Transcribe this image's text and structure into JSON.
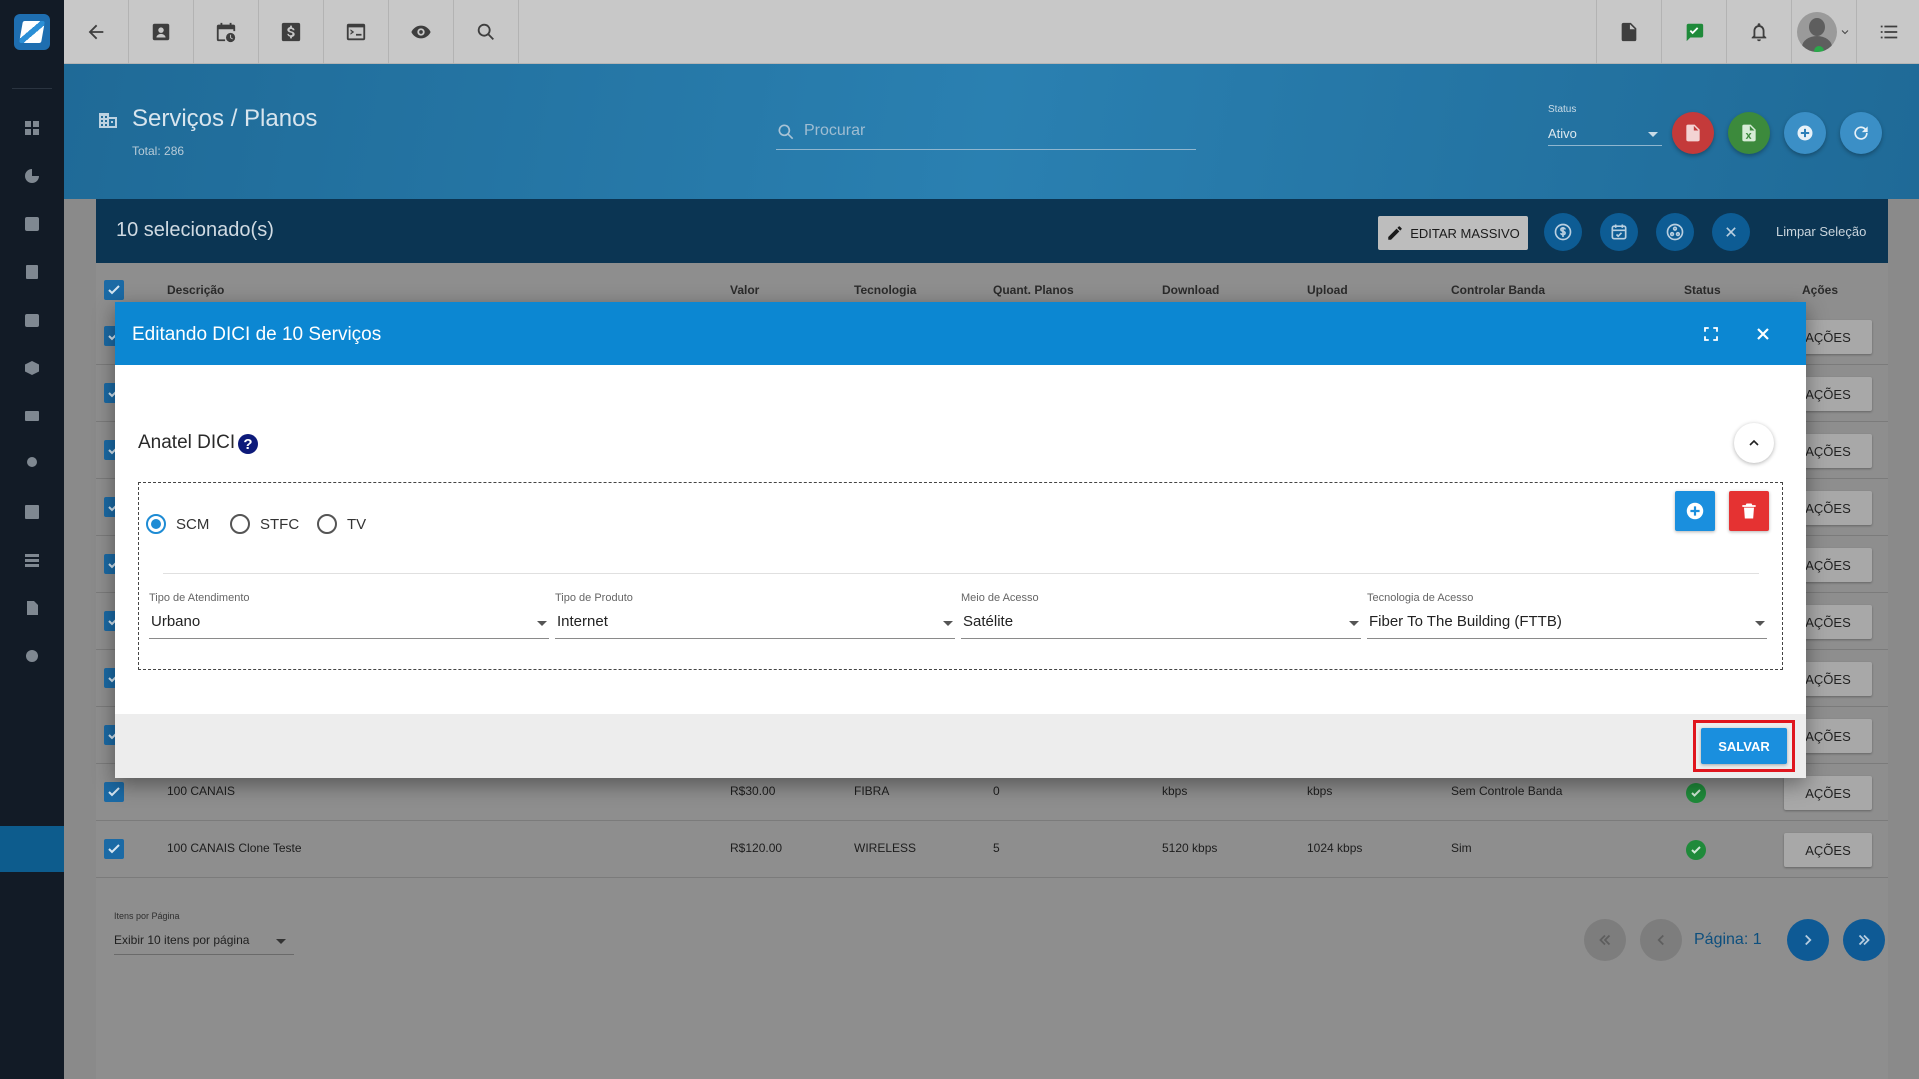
{
  "page": {
    "title": "Serviços / Planos",
    "total": "Total: 286",
    "search_placeholder": "Procurar",
    "status_label": "Status",
    "status_value": "Ativo"
  },
  "selection": {
    "count_text": "10 selecionado(s)",
    "edit_mass": "EDITAR MASSIVO",
    "clear": "Limpar Seleção"
  },
  "table": {
    "columns": [
      "Descrição",
      "Valor",
      "Tecnologia",
      "Quant. Planos",
      "Download",
      "Upload",
      "Controlar Banda",
      "Status",
      "Ações"
    ],
    "action_label": "AÇÕES",
    "rows": [
      {
        "descricao": "100 CANAIS",
        "valor": "R$30.00",
        "tecnologia": "FIBRA",
        "quant": "0",
        "download": "kbps",
        "upload": "kbps",
        "banda": "Sem Controle Banda"
      },
      {
        "descricao": "100 CANAIS Clone Teste",
        "valor": "R$120.00",
        "tecnologia": "WIRELESS",
        "quant": "5",
        "download": "5120 kbps",
        "upload": "1024 kbps",
        "banda": "Sim"
      }
    ]
  },
  "pagination": {
    "items_label": "Itens por Página",
    "items_value": "Exibir 10 itens por página",
    "page_text": "Página: 1"
  },
  "modal": {
    "title": "Editando DICI de 10 Serviços",
    "section": "Anatel DICI",
    "radios": [
      {
        "label": "SCM",
        "checked": true
      },
      {
        "label": "STFC",
        "checked": false
      },
      {
        "label": "TV",
        "checked": false
      }
    ],
    "fields": [
      {
        "label": "Tipo de Atendimento",
        "value": "Urbano"
      },
      {
        "label": "Tipo de Produto",
        "value": "Internet"
      },
      {
        "label": "Meio de Acesso",
        "value": "Satélite"
      },
      {
        "label": "Tecnologia de Acesso",
        "value": "Fiber To The Building (FTTB)"
      }
    ],
    "save": "SALVAR"
  },
  "colors": {
    "primary": "#0c87d2",
    "danger": "#e53232",
    "success": "#1f8a3a",
    "highlight": "#e0161e"
  }
}
